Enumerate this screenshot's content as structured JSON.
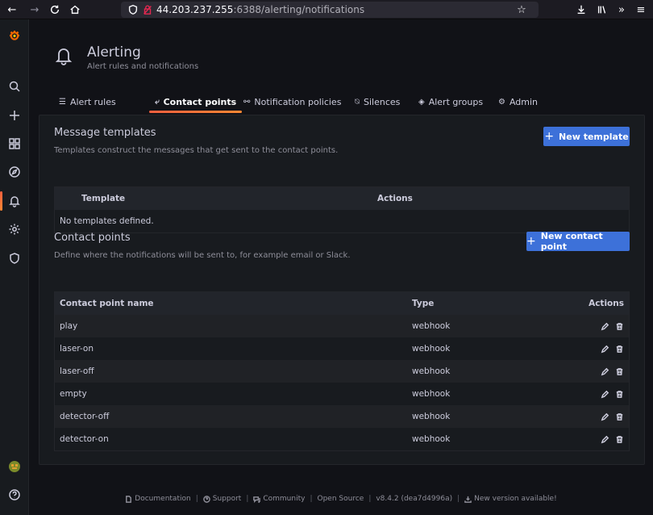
{
  "browser": {
    "url_host": "44.203.237.255",
    "url_rest": ":6388/alerting/notifications"
  },
  "header": {
    "title": "Alerting",
    "subtitle": "Alert rules and notifications"
  },
  "tabs": [
    {
      "label": "Alert rules",
      "icon": "list-icon"
    },
    {
      "label": "Contact points",
      "icon": "comment-alt-share-icon",
      "active": true
    },
    {
      "label": "Notification policies",
      "icon": "sitemap-icon"
    },
    {
      "label": "Silences",
      "icon": "bell-slash-icon"
    },
    {
      "label": "Alert groups",
      "icon": "layer-group-icon"
    },
    {
      "label": "Admin",
      "icon": "cog-icon"
    }
  ],
  "templates": {
    "title": "Message templates",
    "description": "Templates construct the messages that get sent to the contact points.",
    "button": "New template",
    "columns": [
      "Template",
      "Actions"
    ],
    "empty": "No templates defined."
  },
  "contact_points": {
    "title": "Contact points",
    "description": "Define where the notifications will be sent to, for example email or Slack.",
    "button": "New contact point",
    "columns": [
      "Contact point name",
      "Type",
      "Actions"
    ],
    "rows": [
      {
        "name": "play",
        "type": "webhook"
      },
      {
        "name": "laser-on",
        "type": "webhook"
      },
      {
        "name": "laser-off",
        "type": "webhook"
      },
      {
        "name": "empty",
        "type": "webhook"
      },
      {
        "name": "detector-off",
        "type": "webhook"
      },
      {
        "name": "detector-on",
        "type": "webhook"
      }
    ]
  },
  "footer": {
    "documentation": "Documentation",
    "support": "Support",
    "community": "Community",
    "open_source": "Open Source",
    "version": "v8.4.2 (dea7d4996a)",
    "new_version": "New version available!"
  },
  "colors": {
    "accent": "#3d71d9",
    "active_tab": "#ff8833",
    "background": "#111217",
    "panel": "#181b1f"
  }
}
